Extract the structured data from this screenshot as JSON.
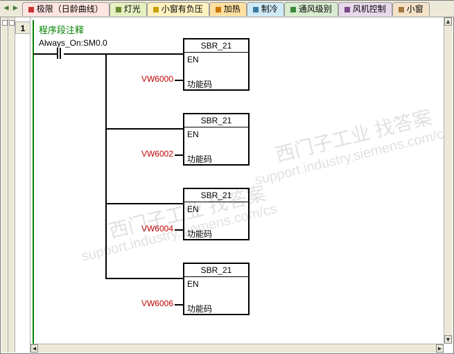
{
  "tabs": [
    {
      "label": "极限（日龄曲线）",
      "bg": "#ffe4e1",
      "mark": "#c83232"
    },
    {
      "label": "灯光",
      "bg": "#e6f0c0",
      "mark": "#6a8a30"
    },
    {
      "label": "小窗有负压",
      "bg": "#fff2c0",
      "mark": "#caa000"
    },
    {
      "label": "加热",
      "bg": "#ffe0a0",
      "mark": "#cc7700"
    },
    {
      "label": "制冷",
      "bg": "#cfeaf7",
      "mark": "#3a7aa0"
    },
    {
      "label": "通风级别",
      "bg": "#d8ecd0",
      "mark": "#3a8a3a"
    },
    {
      "label": "风机控制",
      "bg": "#e8d8ec",
      "mark": "#7a4a8a"
    },
    {
      "label": "小窗",
      "bg": "#f4e2c8",
      "mark": "#a07840"
    }
  ],
  "arrows": {
    "left": "◄",
    "right": "►"
  },
  "network_number": "1",
  "segment_comment": "程序段注释",
  "contact_label": "Always_On:SM0.0",
  "blocks": [
    {
      "name": "SBR_21",
      "en": "EN",
      "fnc": "功能码",
      "param": "VW6000"
    },
    {
      "name": "SBR_21",
      "en": "EN",
      "fnc": "功能码",
      "param": "VW6002"
    },
    {
      "name": "SBR_21",
      "en": "EN",
      "fnc": "功能码",
      "param": "VW6004"
    },
    {
      "name": "SBR_21",
      "en": "EN",
      "fnc": "功能码",
      "param": "VW6006"
    }
  ],
  "watermarks": {
    "line1": "西门子工业 找答案",
    "line2": "support.industry.siemens.com/cs"
  }
}
